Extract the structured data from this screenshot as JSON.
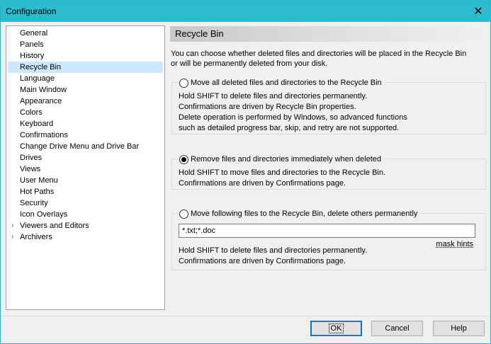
{
  "window": {
    "title": "Configuration"
  },
  "sidebar": {
    "items": [
      {
        "label": "General",
        "expandable": false,
        "selected": false
      },
      {
        "label": "Panels",
        "expandable": false,
        "selected": false
      },
      {
        "label": "History",
        "expandable": false,
        "selected": false
      },
      {
        "label": "Recycle Bin",
        "expandable": false,
        "selected": true
      },
      {
        "label": "Language",
        "expandable": false,
        "selected": false
      },
      {
        "label": "Main Window",
        "expandable": false,
        "selected": false
      },
      {
        "label": "Appearance",
        "expandable": false,
        "selected": false
      },
      {
        "label": "Colors",
        "expandable": false,
        "selected": false
      },
      {
        "label": "Keyboard",
        "expandable": false,
        "selected": false
      },
      {
        "label": "Confirmations",
        "expandable": false,
        "selected": false
      },
      {
        "label": "Change Drive Menu and Drive Bar",
        "expandable": false,
        "selected": false
      },
      {
        "label": "Drives",
        "expandable": false,
        "selected": false
      },
      {
        "label": "Views",
        "expandable": false,
        "selected": false
      },
      {
        "label": "User Menu",
        "expandable": false,
        "selected": false
      },
      {
        "label": "Hot Paths",
        "expandable": false,
        "selected": false
      },
      {
        "label": "Security",
        "expandable": false,
        "selected": false
      },
      {
        "label": "Icon Overlays",
        "expandable": false,
        "selected": false
      },
      {
        "label": "Viewers and Editors",
        "expandable": true,
        "selected": false
      },
      {
        "label": "Archivers",
        "expandable": true,
        "selected": false
      }
    ]
  },
  "panel": {
    "title": "Recycle Bin",
    "intro_line1": "You can choose whether deleted files and directories will be placed in the Recycle Bin",
    "intro_line2": "or will be permanently deleted from your disk.",
    "option1": {
      "label": "Move all deleted files and directories to the Recycle Bin",
      "checked": false,
      "desc": [
        "Hold SHIFT to delete files and directories permanently.",
        "Confirmations are driven by Recycle Bin properties.",
        "Delete operation is performed by Windows, so advanced functions",
        "such as detailed progress bar, skip, and retry are not supported."
      ]
    },
    "option2": {
      "label": "Remove files and directories immediately when deleted",
      "checked": true,
      "desc": [
        "Hold SHIFT to move files and directories to the Recycle Bin.",
        "Confirmations are driven by Confirmations page."
      ]
    },
    "option3": {
      "label": "Move following files to the Recycle Bin, delete others permanently",
      "checked": false,
      "mask_value": "*.txt;*.doc",
      "mask_hints": "mask hints",
      "desc": [
        "Hold SHIFT to delete files and directories permanently.",
        "Confirmations are driven by Confirmations page."
      ]
    }
  },
  "buttons": {
    "ok": "OK",
    "cancel": "Cancel",
    "help": "Help"
  },
  "icons": {
    "close": "close-icon",
    "expand": "chevron-right-icon"
  },
  "colors": {
    "titlebar": "#2bbccf",
    "selection": "#cce8ff",
    "default_button_border": "#0078d7"
  }
}
